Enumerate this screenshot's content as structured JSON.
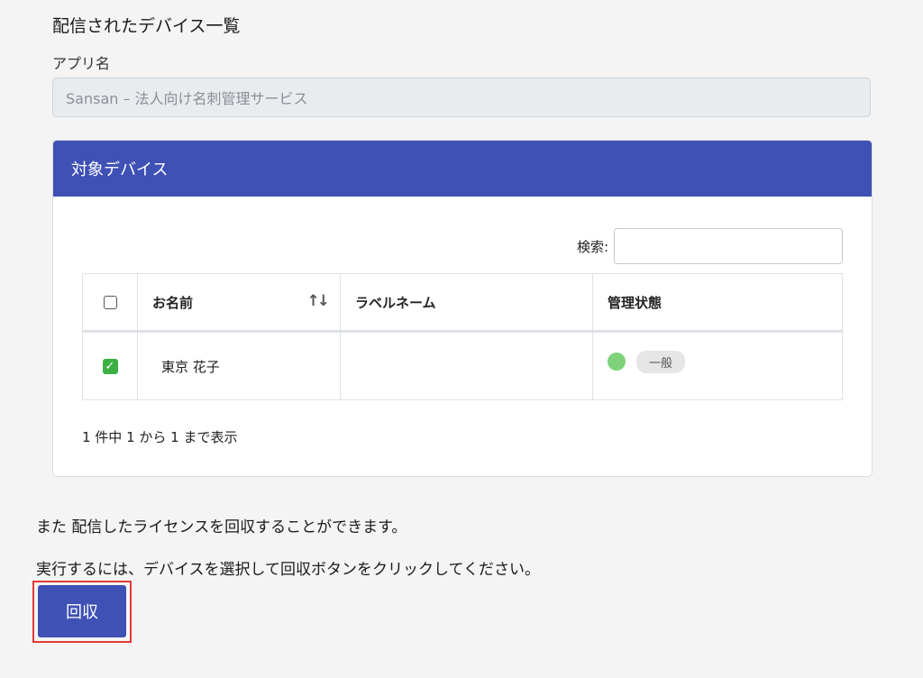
{
  "section_title": "配信されたデバイス一覧",
  "app_field": {
    "label": "アプリ名",
    "value": "Sansan – 法人向け名刺管理サービス"
  },
  "devices_card": {
    "title": "対象デバイス",
    "search": {
      "label": "検索:",
      "value": ""
    },
    "columns": {
      "name": "お名前",
      "label_name": "ラベルネーム",
      "status": "管理状態"
    },
    "sort_icon": "↑↓",
    "rows": [
      {
        "checked": true,
        "name": "東京 花子",
        "label_name": "",
        "status_color": "#7ed37a",
        "status_badge": "一般"
      }
    ],
    "info": "1 件中 1 から 1 まで表示"
  },
  "notes": {
    "line1": "また 配信したライセンスを回収することができます。",
    "line2": "実行するには、デバイスを選択して回収ボタンをクリックしてください。"
  },
  "revoke_button": {
    "label": "回収"
  },
  "colors": {
    "primary": "#3f51b5",
    "highlight_outline": "#e53935",
    "checked": "#3cb043"
  }
}
